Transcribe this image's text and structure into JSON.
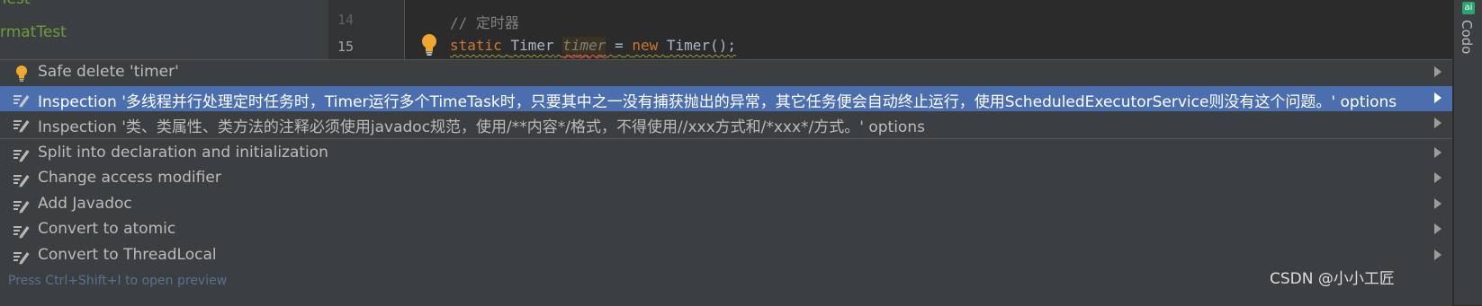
{
  "project_tree": {
    "items": [
      "Test",
      "rmatTest"
    ]
  },
  "editor": {
    "line_numbers": [
      "14",
      "15"
    ],
    "comment_line": "// 定时器",
    "code": {
      "kw_static": "static",
      "type1": "Timer",
      "var": "timer",
      "eq": "=",
      "kw_new": "new",
      "call": "Timer();"
    }
  },
  "right_panel": {
    "badge": "ai",
    "title": "Codo"
  },
  "popup": {
    "items": [
      {
        "label": "Safe delete 'timer'",
        "icon": "bulb-icon"
      },
      {
        "label": "Inspection '多线程并行处理定时任务时，Timer运行多个TimeTask时，只要其中之一没有捕获抛出的异常，其它任务便会自动终止运行，使用ScheduledExecutorService则没有这个问题。' options",
        "icon": "intention-icon",
        "selected": true
      },
      {
        "label": "Inspection '类、类属性、类方法的注释必须使用javadoc规范，使用/**内容*/格式，不得使用//xxx方式和/*xxx*/方式。' options",
        "icon": "intention-icon"
      },
      {
        "label": "Split into declaration and initialization",
        "icon": "intention-icon"
      },
      {
        "label": "Change access modifier",
        "icon": "intention-icon"
      },
      {
        "label": "Add Javadoc",
        "icon": "intention-icon"
      },
      {
        "label": "Convert to atomic",
        "icon": "intention-icon"
      },
      {
        "label": "Convert to ThreadLocal",
        "icon": "intention-icon"
      }
    ],
    "footer_hint": "Press Ctrl+Shift+I to open preview"
  },
  "watermark": "CSDN @小小工匠",
  "colors": {
    "selection": "#4b6eaf",
    "keyword": "#cc7832",
    "bulb": "#f0a732"
  }
}
